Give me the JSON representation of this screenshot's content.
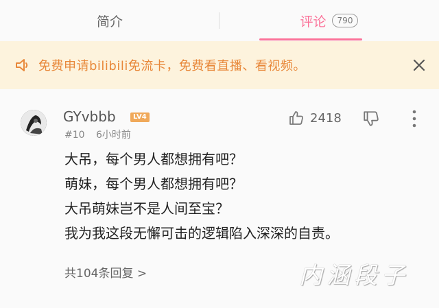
{
  "tabs": {
    "intro_label": "简介",
    "comments_label": "评论",
    "comments_count": "790"
  },
  "notice": {
    "text": "免费申请bilibili免流卡，免费看直播、看视频。",
    "icon": "speaker-icon",
    "close_icon": "close-icon"
  },
  "comment": {
    "username": "GYvbbb",
    "level": "LV4",
    "floor": "#10",
    "time": "6小时前",
    "likes": "2418",
    "lines": [
      "大吊，每个男人都想拥有吧？",
      "萌妹，每个男人都想拥有吧？",
      "大吊萌妹岂不是人间至宝？",
      "我为我这段无懈可击的逻辑陷入深深的自责。"
    ],
    "replies_label": "共104条回复 >"
  },
  "watermark": "内涵段子",
  "colors": {
    "accent": "#fb7299",
    "notice_bg": "#fdf3dd",
    "notice_text": "#e8883a",
    "level_badge": "#f0a95a"
  }
}
